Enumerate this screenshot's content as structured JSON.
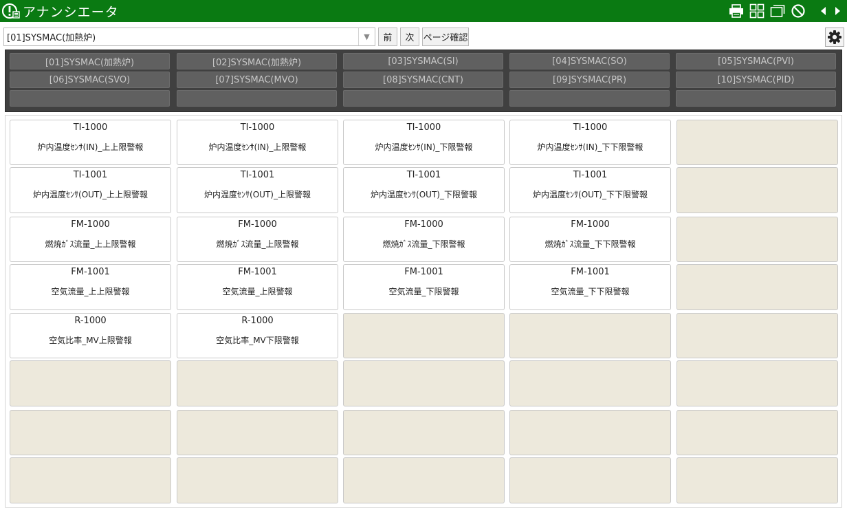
{
  "app": {
    "title": "アナンシエータ"
  },
  "toolbar": {
    "selected_page": "[01]SYSMAC(加熱炉)",
    "prev_label": "前",
    "next_label": "次",
    "confirm_label": "ページ確認"
  },
  "tabs": [
    "[01]SYSMAC(加熱炉)",
    "[02]SYSMAC(加熱炉)",
    "[03]SYSMAC(SI)",
    "[04]SYSMAC(SO)",
    "[05]SYSMAC(PVI)",
    "[06]SYSMAC(SVO)",
    "[07]SYSMAC(MVO)",
    "[08]SYSMAC(CNT)",
    "[09]SYSMAC(PR)",
    "[10]SYSMAC(PID)",
    "",
    "",
    "",
    "",
    ""
  ],
  "alarms": [
    [
      {
        "tag": "TI-1000",
        "msg": "炉内温度ｾﾝｻ(IN)_上上限警報"
      },
      {
        "tag": "TI-1000",
        "msg": "炉内温度ｾﾝｻ(IN)_上限警報"
      },
      {
        "tag": "TI-1000",
        "msg": "炉内温度ｾﾝｻ(IN)_下限警報"
      },
      {
        "tag": "TI-1000",
        "msg": "炉内温度ｾﾝｻ(IN)_下下限警報"
      },
      null
    ],
    [
      {
        "tag": "TI-1001",
        "msg": "炉内温度ｾﾝｻ(OUT)_上上限警報"
      },
      {
        "tag": "TI-1001",
        "msg": "炉内温度ｾﾝｻ(OUT)_上限警報"
      },
      {
        "tag": "TI-1001",
        "msg": "炉内温度ｾﾝｻ(OUT)_下限警報"
      },
      {
        "tag": "TI-1001",
        "msg": "炉内温度ｾﾝｻ(OUT)_下下限警報"
      },
      null
    ],
    [
      {
        "tag": "FM-1000",
        "msg": "燃焼ｶﾞｽ流量_上上限警報"
      },
      {
        "tag": "FM-1000",
        "msg": "燃焼ｶﾞｽ流量_上限警報"
      },
      {
        "tag": "FM-1000",
        "msg": "燃焼ｶﾞｽ流量_下限警報"
      },
      {
        "tag": "FM-1000",
        "msg": "燃焼ｶﾞｽ流量_下下限警報"
      },
      null
    ],
    [
      {
        "tag": "FM-1001",
        "msg": "空気流量_上上限警報"
      },
      {
        "tag": "FM-1001",
        "msg": "空気流量_上限警報"
      },
      {
        "tag": "FM-1001",
        "msg": "空気流量_下限警報"
      },
      {
        "tag": "FM-1001",
        "msg": "空気流量_下下限警報"
      },
      null
    ],
    [
      {
        "tag": "R-1000",
        "msg": "空気比率_MV上限警報"
      },
      {
        "tag": "R-1000",
        "msg": "空気比率_MV下限警報"
      },
      null,
      null,
      null
    ],
    [
      null,
      null,
      null,
      null,
      null
    ],
    [
      null,
      null,
      null,
      null,
      null
    ],
    [
      null,
      null,
      null,
      null,
      null
    ]
  ],
  "colors": {
    "titlebar": "#0a7a12",
    "tab_panel": "#404040",
    "tab": "#606060",
    "empty_cell": "#ede9dc"
  },
  "icons": [
    "alert-info-icon",
    "print-icon",
    "grid-layout-icon",
    "window-icon",
    "prohibit-icon",
    "arrow-left-icon",
    "arrow-right-icon",
    "gear-icon"
  ]
}
